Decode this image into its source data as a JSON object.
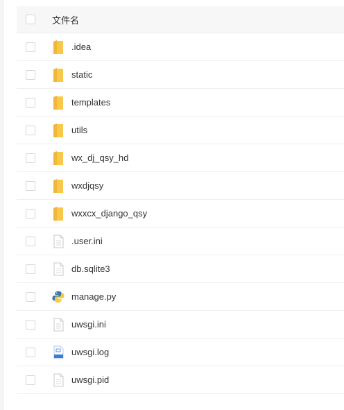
{
  "header": {
    "name_label": "文件名"
  },
  "files": [
    {
      "name": ".idea",
      "icon": "folder-icon"
    },
    {
      "name": "static",
      "icon": "folder-icon"
    },
    {
      "name": "templates",
      "icon": "folder-icon"
    },
    {
      "name": "utils",
      "icon": "folder-icon"
    },
    {
      "name": "wx_dj_qsy_hd",
      "icon": "folder-icon"
    },
    {
      "name": "wxdjqsy",
      "icon": "folder-icon"
    },
    {
      "name": "wxxcx_django_qsy",
      "icon": "folder-icon"
    },
    {
      "name": ".user.ini",
      "icon": "file-icon"
    },
    {
      "name": "db.sqlite3",
      "icon": "file-icon"
    },
    {
      "name": "manage.py",
      "icon": "python-icon"
    },
    {
      "name": "uwsgi.ini",
      "icon": "file-icon"
    },
    {
      "name": "uwsgi.log",
      "icon": "log-file-icon"
    },
    {
      "name": "uwsgi.pid",
      "icon": "file-icon"
    }
  ],
  "colors": {
    "folder": "#f7c84a",
    "file_border": "#c9c9c9",
    "log_accent": "#3a7bd5",
    "python_blue": "#3b77a8",
    "python_yellow": "#f5c93d"
  }
}
